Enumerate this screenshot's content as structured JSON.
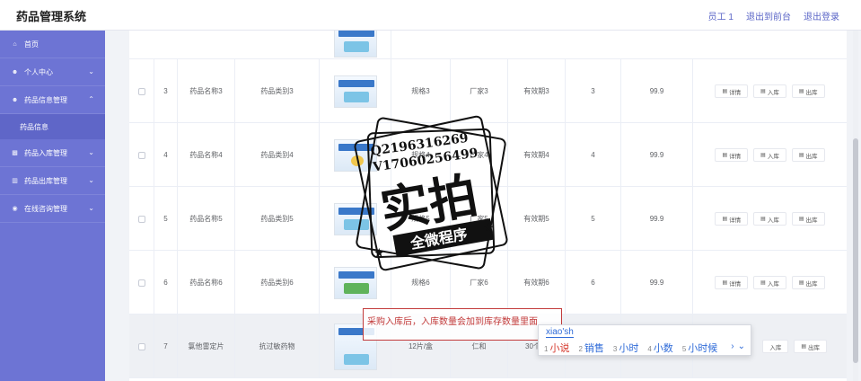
{
  "app": {
    "title": "药品管理系统"
  },
  "header": {
    "user": "员工 1",
    "to_front": "退出到前台",
    "logout": "退出登录"
  },
  "sidebar": {
    "items": [
      {
        "label": "首页",
        "icon": "home-icon",
        "has_children": false
      },
      {
        "label": "个人中心",
        "icon": "user-icon",
        "has_children": true
      },
      {
        "label": "药品信息管理",
        "icon": "user-icon",
        "has_children": true,
        "expanded": true,
        "children": [
          {
            "label": "药品信息"
          }
        ]
      },
      {
        "label": "药品入库管理",
        "icon": "comment-icon",
        "has_children": true
      },
      {
        "label": "药品出库管理",
        "icon": "bar-chart-icon",
        "has_children": true
      },
      {
        "label": "在线咨询管理",
        "icon": "pin-icon",
        "has_children": true
      }
    ]
  },
  "rows": [
    {
      "no": "3",
      "name": "药品名称3",
      "category": "药品类别3",
      "spec": "规格3",
      "maker": "厂家3",
      "expiry": "有效期3",
      "qty": "3",
      "price": "99.9",
      "thumb": "blue"
    },
    {
      "no": "4",
      "name": "药品名称4",
      "category": "药品类别4",
      "spec": "规格4",
      "maker": "厂家4",
      "expiry": "有效期4",
      "qty": "4",
      "price": "99.9",
      "thumb": "yellow"
    },
    {
      "no": "5",
      "name": "药品名称5",
      "category": "药品类别5",
      "spec": "规格5",
      "maker": "厂家5",
      "expiry": "有效期5",
      "qty": "5",
      "price": "99.9",
      "thumb": "blue"
    },
    {
      "no": "6",
      "name": "药品名称6",
      "category": "药品类别6",
      "spec": "规格6",
      "maker": "厂家6",
      "expiry": "有效期6",
      "qty": "6",
      "price": "99.9",
      "thumb": "green"
    },
    {
      "no": "7",
      "name": "氯他雷定片",
      "category": "抗过敏药物",
      "spec": "12片/盒",
      "maker": "仁和",
      "expiry": "30个月",
      "qty": "",
      "price": "",
      "thumb": "blue"
    }
  ],
  "actions": {
    "detail": "详情",
    "stock_in": "入库",
    "stock_out": "出库"
  },
  "watermark": {
    "contact1": "Q2196316269",
    "contact2": "V17060256499",
    "main": "实拍",
    "sub": "全微程序"
  },
  "annotation": {
    "text": "采购入库后，入库数量会加到库存数量里面"
  },
  "ime": {
    "input": "xiao'sh",
    "candidates": [
      {
        "n": "1",
        "text": "小说"
      },
      {
        "n": "2",
        "text": "销售"
      },
      {
        "n": "3",
        "text": "小时"
      },
      {
        "n": "4",
        "text": "小数"
      },
      {
        "n": "5",
        "text": "小时候"
      }
    ]
  },
  "colors": {
    "sidebar": "#6d74d4",
    "accent": "#5b66c7",
    "annotation": "#c23b3b"
  }
}
